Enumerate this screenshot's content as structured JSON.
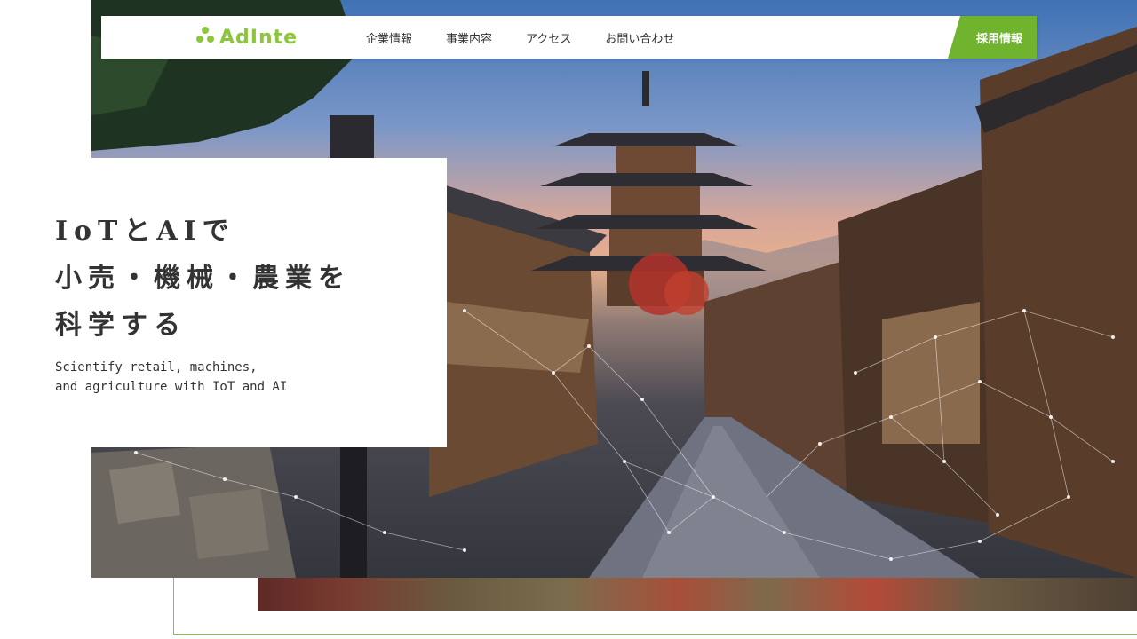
{
  "header": {
    "logo_text": "AdInte",
    "nav": [
      "企業情報",
      "事業内容",
      "アクセス",
      "お問い合わせ"
    ],
    "cta_label": "採用情報"
  },
  "hero": {
    "headline": "IoTとAIで\n小売・機械・農業を\n科学する",
    "subline": "Scientify retail, machines,\nand agriculture with IoT and AI"
  },
  "colors": {
    "brand_green": "#8cc63f",
    "cta_green": "#6fb32e",
    "text": "#333333"
  },
  "icons": [
    "logo-mark-icon"
  ]
}
